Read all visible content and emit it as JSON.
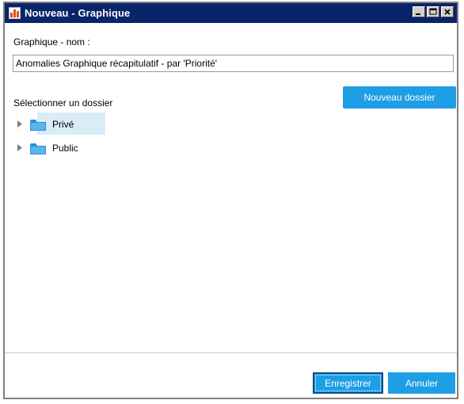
{
  "window": {
    "title": "Nouveau - Graphique",
    "icon": "chart-icon",
    "controls": [
      "minimize-icon",
      "maximize-icon",
      "close-icon"
    ]
  },
  "form": {
    "name_label": "Graphique - nom :",
    "name_value": "Anomalies Graphique récapitulatif - par 'Priorité'",
    "folder_label": "Sélectionner un dossier",
    "new_folder_label": "Nouveau dossier"
  },
  "tree": {
    "items": [
      {
        "label": "Privé",
        "icon": "folder-icon",
        "selected": true
      },
      {
        "label": "Public",
        "icon": "folder-icon",
        "selected": false
      }
    ]
  },
  "footer": {
    "save_label": "Enregistrer",
    "cancel_label": "Annuler"
  },
  "colors": {
    "titlebar": "#0a246a",
    "accent": "#1e9ee4",
    "selection": "#d9ecf8"
  }
}
